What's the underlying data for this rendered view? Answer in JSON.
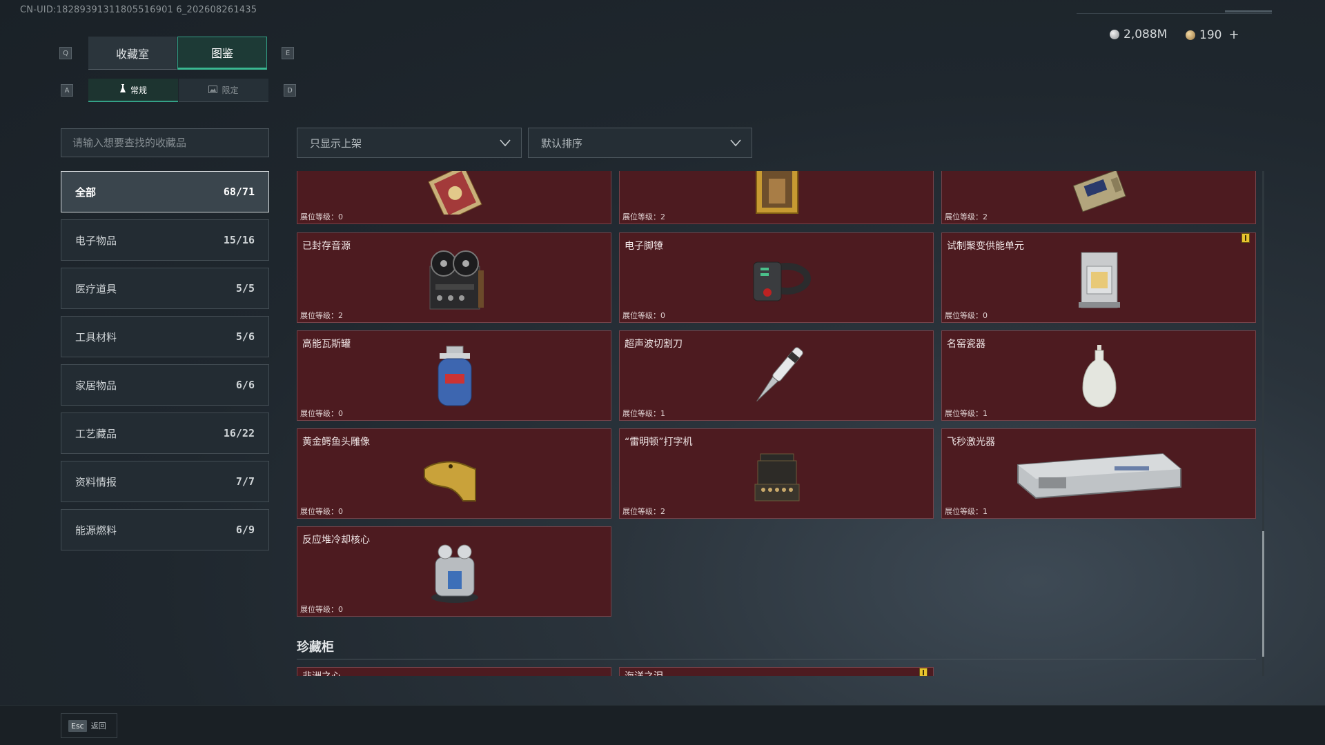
{
  "uid": "CN-UID:18289391311805516901 6_202608261435",
  "hotkeys": {
    "q": "Q",
    "e": "E",
    "a": "A",
    "d": "D"
  },
  "tabs": [
    {
      "label": "收藏室"
    },
    {
      "label": "图鉴"
    }
  ],
  "subtabs": [
    {
      "label": "常规",
      "icon": "flask-icon"
    },
    {
      "label": "限定",
      "icon": "image-icon"
    }
  ],
  "currency": {
    "silver": "2,088M",
    "gold": "190",
    "plus": "+"
  },
  "search": {
    "placeholder": "请输入想要查找的收藏品"
  },
  "filters": {
    "shelf": "只显示上架",
    "sort": "默认排序"
  },
  "categories": [
    {
      "label": "全部",
      "count": "68/71"
    },
    {
      "label": "电子物品",
      "count": "15/16"
    },
    {
      "label": "医疗道具",
      "count": "5/5"
    },
    {
      "label": "工具材料",
      "count": "5/6"
    },
    {
      "label": "家居物品",
      "count": "6/6"
    },
    {
      "label": "工艺藏品",
      "count": "16/22"
    },
    {
      "label": "资料情报",
      "count": "7/7"
    },
    {
      "label": "能源燃料",
      "count": "6/9"
    }
  ],
  "cards": [
    {
      "name": "",
      "level": "展位等级：0",
      "icon": "ornate-book-icon"
    },
    {
      "name": "",
      "level": "展位等级：2",
      "icon": "painting-icon"
    },
    {
      "name": "",
      "level": "展位等级：2",
      "icon": "device-icon"
    },
    {
      "name": "已封存音源",
      "level": "展位等级：2",
      "icon": "tape-recorder-icon"
    },
    {
      "name": "电子脚镣",
      "level": "展位等级：0",
      "icon": "ankle-monitor-icon"
    },
    {
      "name": "试制聚变供能单元",
      "level": "展位等级：0",
      "icon": "fusion-unit-icon",
      "badge": true
    },
    {
      "name": "高能瓦斯罐",
      "level": "展位等级：0",
      "icon": "gas-canister-icon"
    },
    {
      "name": "超声波切割刀",
      "level": "展位等级：1",
      "icon": "ultrasonic-knife-icon"
    },
    {
      "name": "名窑瓷器",
      "level": "展位等级：1",
      "icon": "porcelain-vase-icon"
    },
    {
      "name": "黄金鳄鱼头雕像",
      "level": "展位等级：0",
      "icon": "golden-crocodile-icon"
    },
    {
      "name": "“雷明顿”打字机",
      "level": "展位等级：2",
      "icon": "typewriter-icon"
    },
    {
      "name": "飞秒激光器",
      "level": "展位等级：1",
      "icon": "laser-case-icon"
    },
    {
      "name": "反应堆冷却核心",
      "level": "展位等级：0",
      "icon": "reactor-core-icon"
    }
  ],
  "cabinet": {
    "title": "珍藏柜",
    "cards": [
      {
        "name": "非洲之心"
      },
      {
        "name": "海洋之泪",
        "badge": true
      }
    ]
  },
  "footer": {
    "key": "Esc",
    "label": "返回"
  },
  "colors": {
    "accent": "#34a187",
    "card_bg": "#4d1b20",
    "badge": "#e8c42e"
  }
}
